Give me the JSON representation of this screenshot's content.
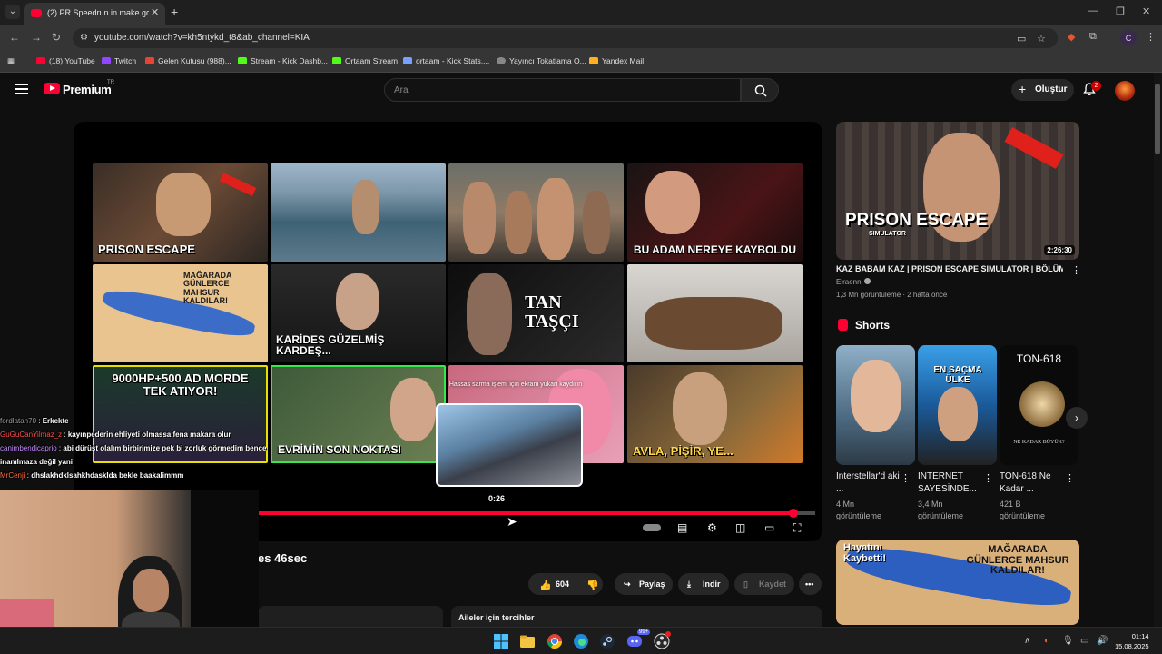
{
  "browser": {
    "tab_title": "(2) PR Speedrun in make good",
    "url": "youtube.com/watch?v=kh5ntykd_t8&ab_channel=KIA",
    "profile_letter": "C",
    "bookmarks": [
      "(18) YouTube",
      "Twitch",
      "Gelen Kutusu (988)...",
      "Stream - Kick Dashb...",
      "Ortaam Stream",
      "ortaam - Kick Stats,...",
      "Yayıncı Tokatlama O...",
      "Yandex Mail"
    ]
  },
  "header": {
    "brand": "Premium",
    "country": "TR",
    "search_placeholder": "Ara",
    "create_label": "Oluştur",
    "notification_count": "2"
  },
  "player": {
    "end_screen": [
      {
        "text": "PRISON ESCAPE"
      },
      {
        "text": ""
      },
      {
        "text": ""
      },
      {
        "text": "BU ADAM NEREYE KAYBOLDU"
      },
      {
        "text": "MAĞARADA GÜNLERCE MAHSUR KALDILAR!"
      },
      {
        "text": "KARİDES GÜZELMİŞ KARDEŞ..."
      },
      {
        "text": "TAN TAŞÇI"
      },
      {
        "text": ""
      },
      {
        "text": "9000HP+500 AD MORDE TEK ATIYOR!"
      },
      {
        "text": "EVRİMİN SON NOKTASI"
      },
      {
        "text": ""
      },
      {
        "text": "AVLA, PİŞİR, YE..."
      }
    ],
    "preview_note": "Hassas sarma işlemi için ekranı yukarı kaydırın",
    "preview_time": "0:26",
    "progress": 0.97
  },
  "video": {
    "title_fragment": "es 46sec",
    "likes": "604",
    "share_label": "Paylaş",
    "download_label": "İndir",
    "save_label": "Kaydet",
    "preferences_label": "Aileler için tercihler"
  },
  "sidebar": {
    "main": {
      "title": "KAZ BABAM KAZ | PRISON ESCAPE SIMULATOR | BÖLÜM 1",
      "channel": "Elraenn",
      "meta": "1,3 Mn görüntüleme · 2 hafta önce",
      "duration": "2:26:30",
      "thumb_text": "PRISON ESCAPE",
      "thumb_sub": "SIMULATOR"
    },
    "shorts_title": "Shorts",
    "shorts": [
      {
        "title": "Interstellar'd aki ...",
        "views": "4 Mn görüntüleme"
      },
      {
        "title": "İNTERNET SAYESİNDE...",
        "views": "3,4 Mn görüntüleme",
        "overlay": "EN SAÇMA ÜLKE"
      },
      {
        "title": "TON-618 Ne Kadar ...",
        "views": "421 B görüntüleme",
        "overlay": "TON-618",
        "caption": "NE KADAR BÜYÜK?"
      }
    ],
    "next_thumb_left": "Hayatını Kaybetti!",
    "next_thumb_right": "MAĞARADA GÜNLERCE MAHSUR KALDILAR!"
  },
  "chat": [
    {
      "user": "fordlatan70",
      "color": "#9a9a9a",
      "msg": "Erkekte"
    },
    {
      "user": "GuGuCanYilmaz_z",
      "color": "#ff4d4d",
      "msg": "kayınpederin ehliyeti olmassa fena makara olur"
    },
    {
      "user": "canimbendicaprio",
      "color": "#c58bff",
      "msg": "abi dürüst olalım birbirimize pek bi zorluk görmedim bence"
    },
    {
      "user": "",
      "color": "#ffffff",
      "msg": "inanılmaza değil yani"
    },
    {
      "user": "MrCenji",
      "color": "#ff6a3d",
      "msg": "dhslakhdklsahkhdaskIda bekle baakalimmm"
    }
  ],
  "taskbar": {
    "time": "01:14",
    "date": "15.08.2025",
    "steam_badge": "99+"
  },
  "colors": {
    "accent": "#ff0033",
    "background": "#0f0f0f"
  }
}
